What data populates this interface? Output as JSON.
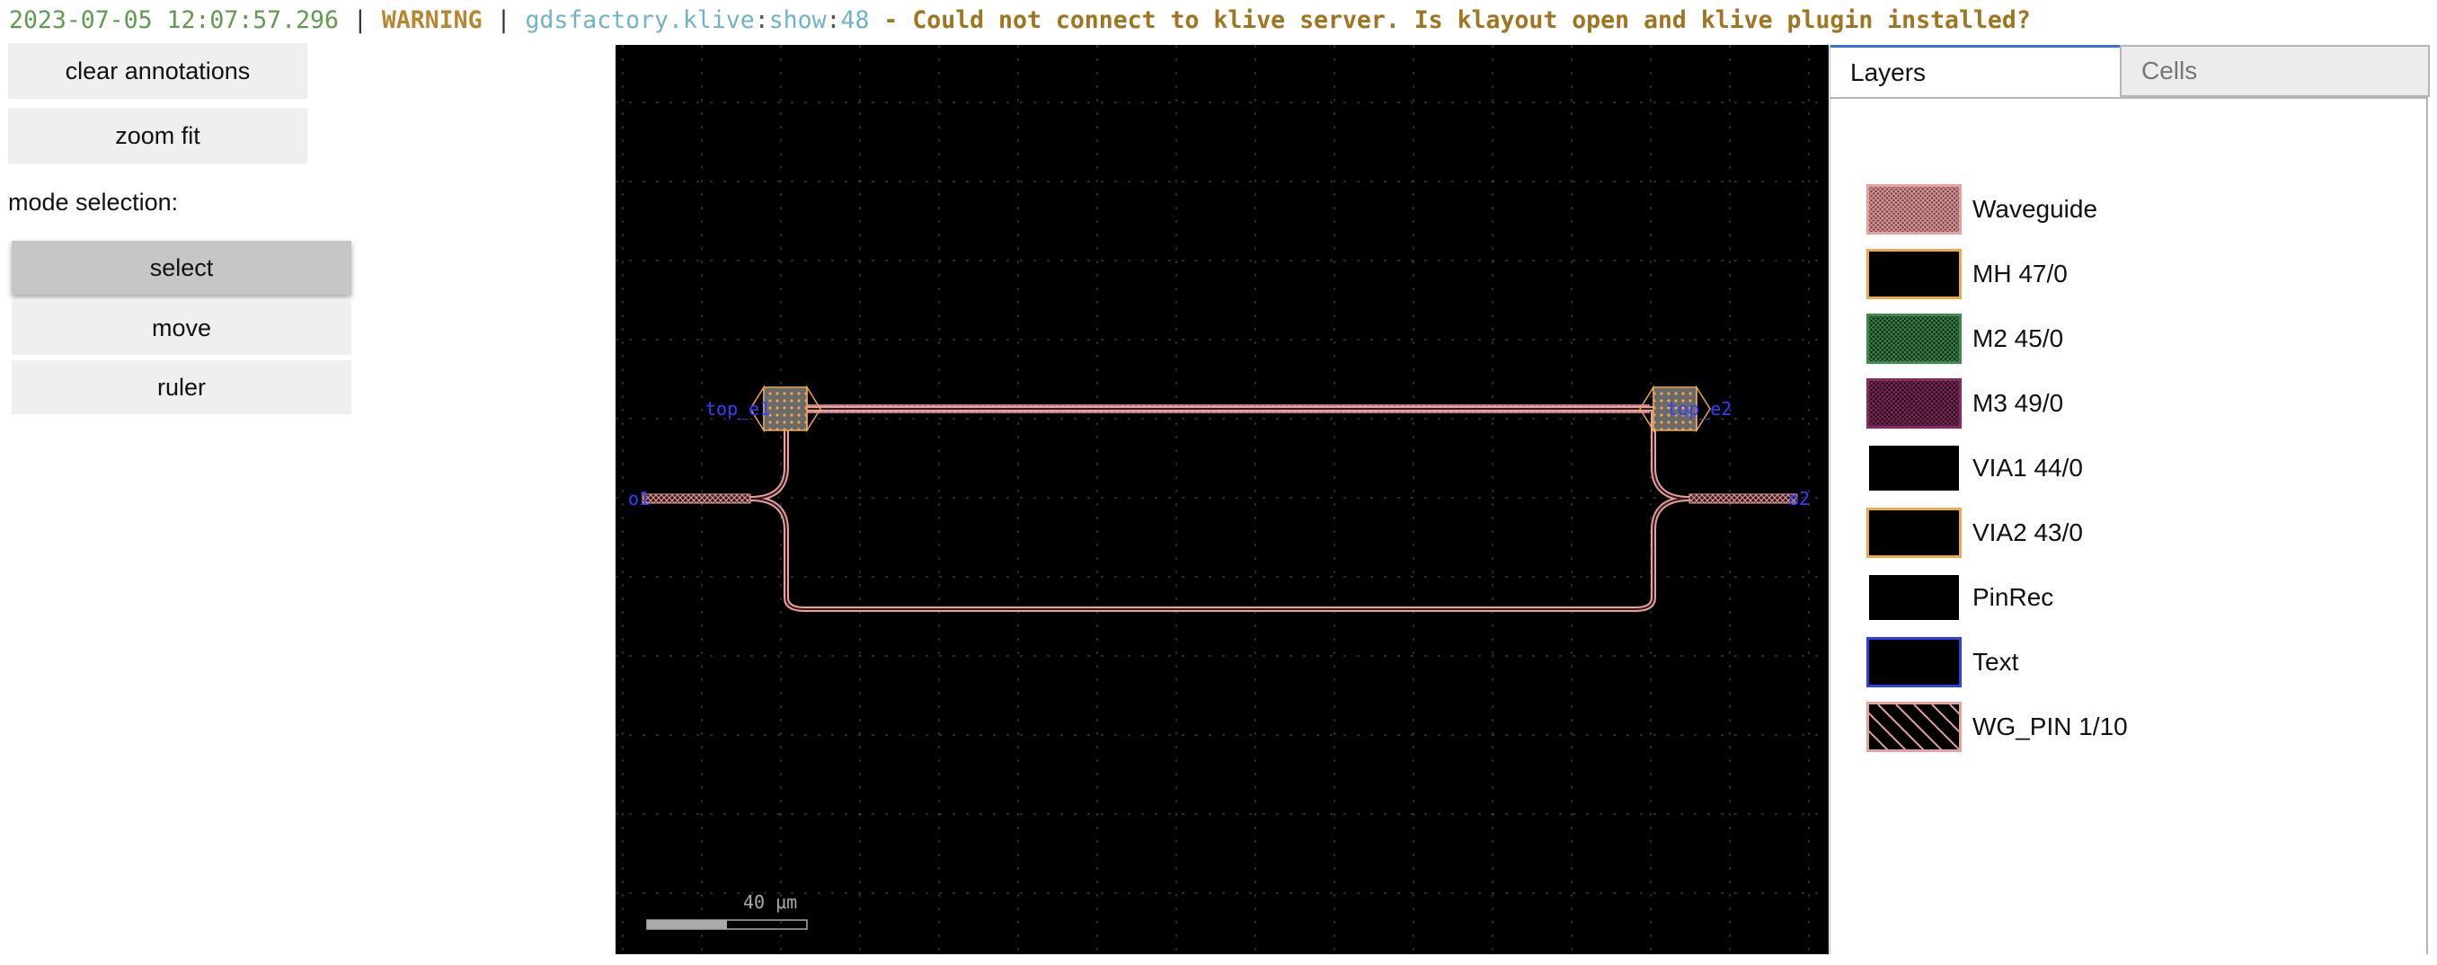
{
  "log": {
    "timestamp": "2023-07-05 12:07:57.296",
    "separator": "|",
    "level": "WARNING",
    "module": "gdsfactory.klive",
    "colon1": ":",
    "function": "show",
    "colon2": ":",
    "line": "48",
    "dash": "-",
    "message": "Could not connect to klive server. Is klayout open and klive plugin installed?"
  },
  "toolbar": {
    "clear_annotations": "clear annotations",
    "zoom_fit": "zoom fit",
    "mode_label": "mode selection:",
    "modes": [
      {
        "label": "select",
        "active": true
      },
      {
        "label": "move",
        "active": false
      },
      {
        "label": "ruler",
        "active": false
      }
    ]
  },
  "viewer": {
    "port_labels": [
      "top_e1",
      "top_e2",
      "o1",
      "o2"
    ],
    "scale_bar_label": "40 µm"
  },
  "panel": {
    "tabs": [
      "Layers",
      "Cells"
    ],
    "active_tab": "Layers",
    "layers": [
      {
        "name": "Waveguide",
        "color": "#e6a0a0",
        "fill": "crosshatch"
      },
      {
        "name": "MH 47/0",
        "color": "#f2a64b",
        "fill": "solid"
      },
      {
        "name": "M2 45/0",
        "color": "#2f6b3a",
        "fill": "crosshatch"
      },
      {
        "name": "M3 49/0",
        "color": "#6b1f4a",
        "fill": "crosshatch"
      },
      {
        "name": "VIA1 44/0",
        "color": "#ffffff",
        "fill": "solid"
      },
      {
        "name": "VIA2 43/0",
        "color": "#f2a64b",
        "fill": "solid"
      },
      {
        "name": "PinRec",
        "color": "#ffffff",
        "fill": "solid"
      },
      {
        "name": "Text",
        "color": "#2f3cf0",
        "fill": "solid"
      },
      {
        "name": "WG_PIN 1/10",
        "color": "#e6a0a0",
        "fill": "diagonal"
      }
    ]
  }
}
